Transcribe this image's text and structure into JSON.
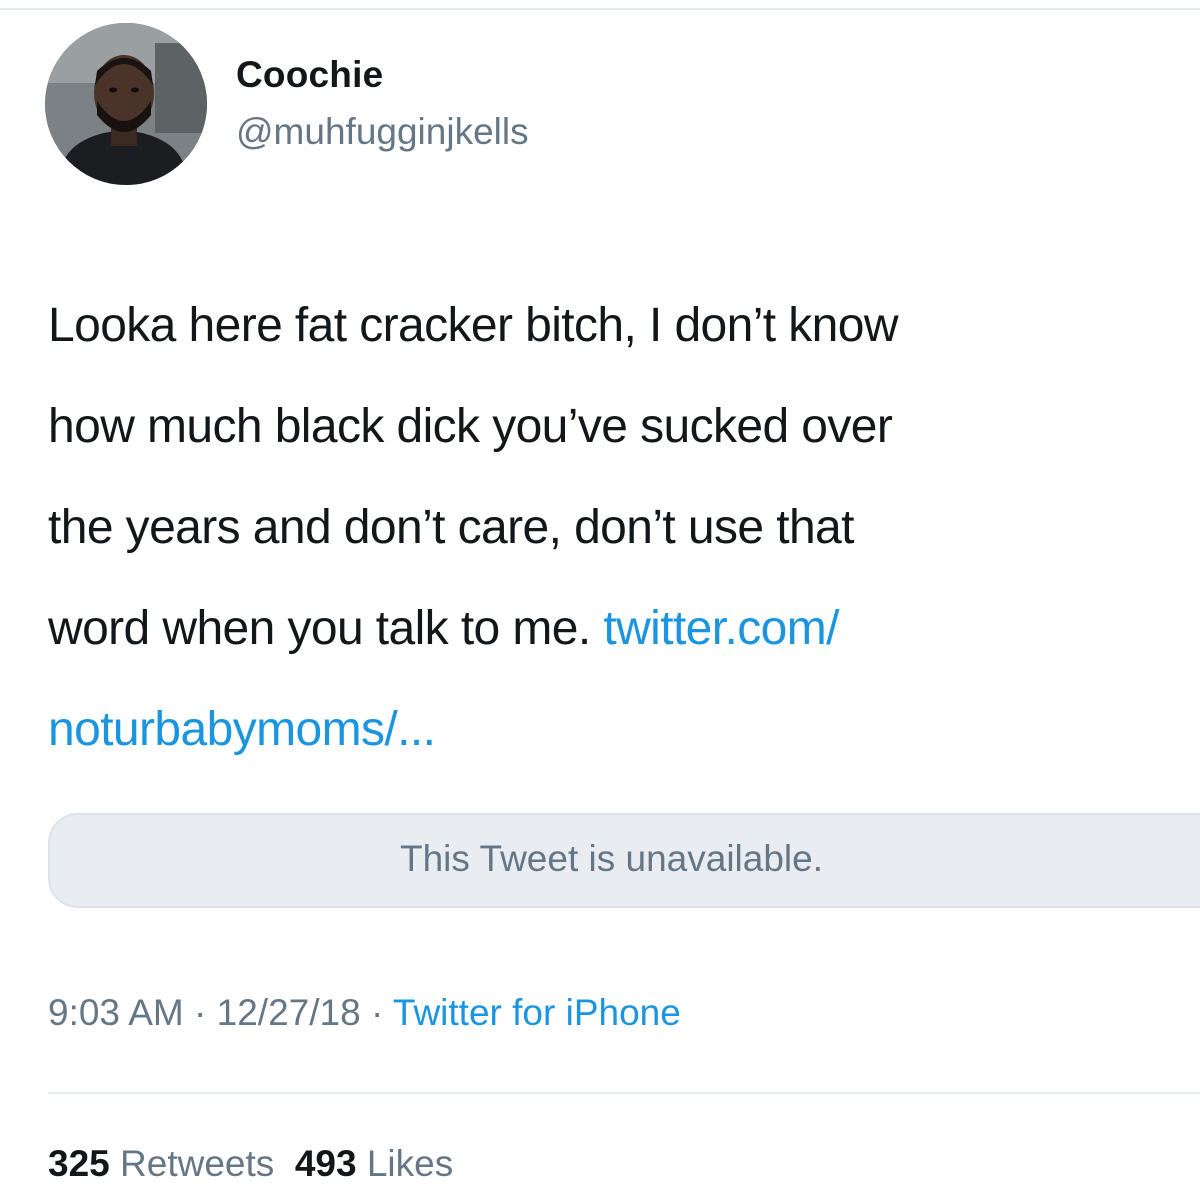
{
  "tweet": {
    "display_name": "Coochie",
    "handle": "@muhfugginjkells",
    "text_lines": [
      "Looka here fat cracker bitch, I don’t know",
      "how much black dick you’ve sucked over",
      "the years and don’t care, don’t use that",
      "word when you talk to me. "
    ],
    "link_part1": "twitter.com/",
    "link_part2": "noturbabymoms/...",
    "quoted_tweet_text": "This Tweet is unavailable.",
    "time": "9:03 AM",
    "date": "12/27/18",
    "separator": " · ",
    "source": "Twitter for iPhone",
    "retweets_count": "325",
    "retweets_label": "Retweets",
    "likes_count": "493",
    "likes_label": "Likes"
  },
  "colors": {
    "text": "#14171a",
    "secondary": "#657786",
    "link": "#1b95e0",
    "card_bg": "#e9edf2",
    "rule": "#e6ecf0"
  },
  "icons": [
    "avatar-photo"
  ]
}
